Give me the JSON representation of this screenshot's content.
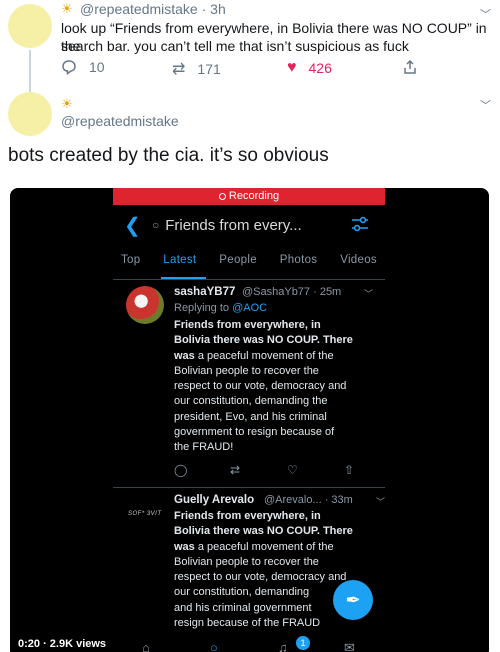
{
  "parent_tweet": {
    "handle": "@repeatedmistake",
    "time": "· 3h",
    "text_line1": "look up “Friends from everywhere, in Bolivia there was NO COUP” in the",
    "text_line2": "search bar. you can’t tell me that isn’t suspicious as fuck",
    "replies": "10",
    "retweets": "171",
    "likes": "426"
  },
  "reply_tweet": {
    "handle": "@repeatedmistake",
    "text": "bots created by the cia. it’s so obvious"
  },
  "recording": {
    "label": "Recording",
    "search_query": "Friends from every...",
    "tabs": [
      "Top",
      "Latest",
      "People",
      "Photos",
      "Videos"
    ],
    "tweets": [
      {
        "name": "sashaYB77",
        "meta": "@SashaYb77 · 25m",
        "replying_prefix": "Replying to",
        "replying_to": "@AOC",
        "bold_line1": "Friends from everywhere, in",
        "bold_line2": "Bolivia there was NO COUP. There",
        "bold_line3": "was",
        "line3_rest": " a peaceful movement of the",
        "line4": "Bolivian people to recover the",
        "line5": "respect to our vote, democracy and",
        "line6": "our constitution, demanding the",
        "line7": "president, Evo, and his criminal",
        "line8": "government to resign because of",
        "line9": "the FRAUD!"
      },
      {
        "name": "Guelly Arevalo",
        "meta": "@Arevalo... · 33m",
        "avatar_text": "SOF* 3VIT",
        "bold_line1": "Friends from everywhere, in",
        "bold_line2": "Bolivia there was NO COUP. There",
        "bold_line3": "was",
        "line3_rest": " a peaceful movement of the",
        "line4": "Bolivian people to recover the",
        "line5": "respect to our vote, democracy and",
        "line6": "our constitution, demanding",
        "line7": "and his criminal government",
        "line8": "resign because of the FRAUD"
      }
    ],
    "video_time": "0:20 · 2.9K views",
    "notif_count": "1"
  },
  "colors": {
    "accent": "#1da1f2",
    "like": "#e0245e",
    "recording": "#e0242f"
  },
  "icons": [
    "sun-icon",
    "reply-icon",
    "retweet-icon",
    "heart-icon",
    "share-icon",
    "chevron-down-icon",
    "search-icon",
    "filter-icon",
    "compose-icon",
    "home-icon",
    "bell-icon",
    "mail-icon"
  ]
}
